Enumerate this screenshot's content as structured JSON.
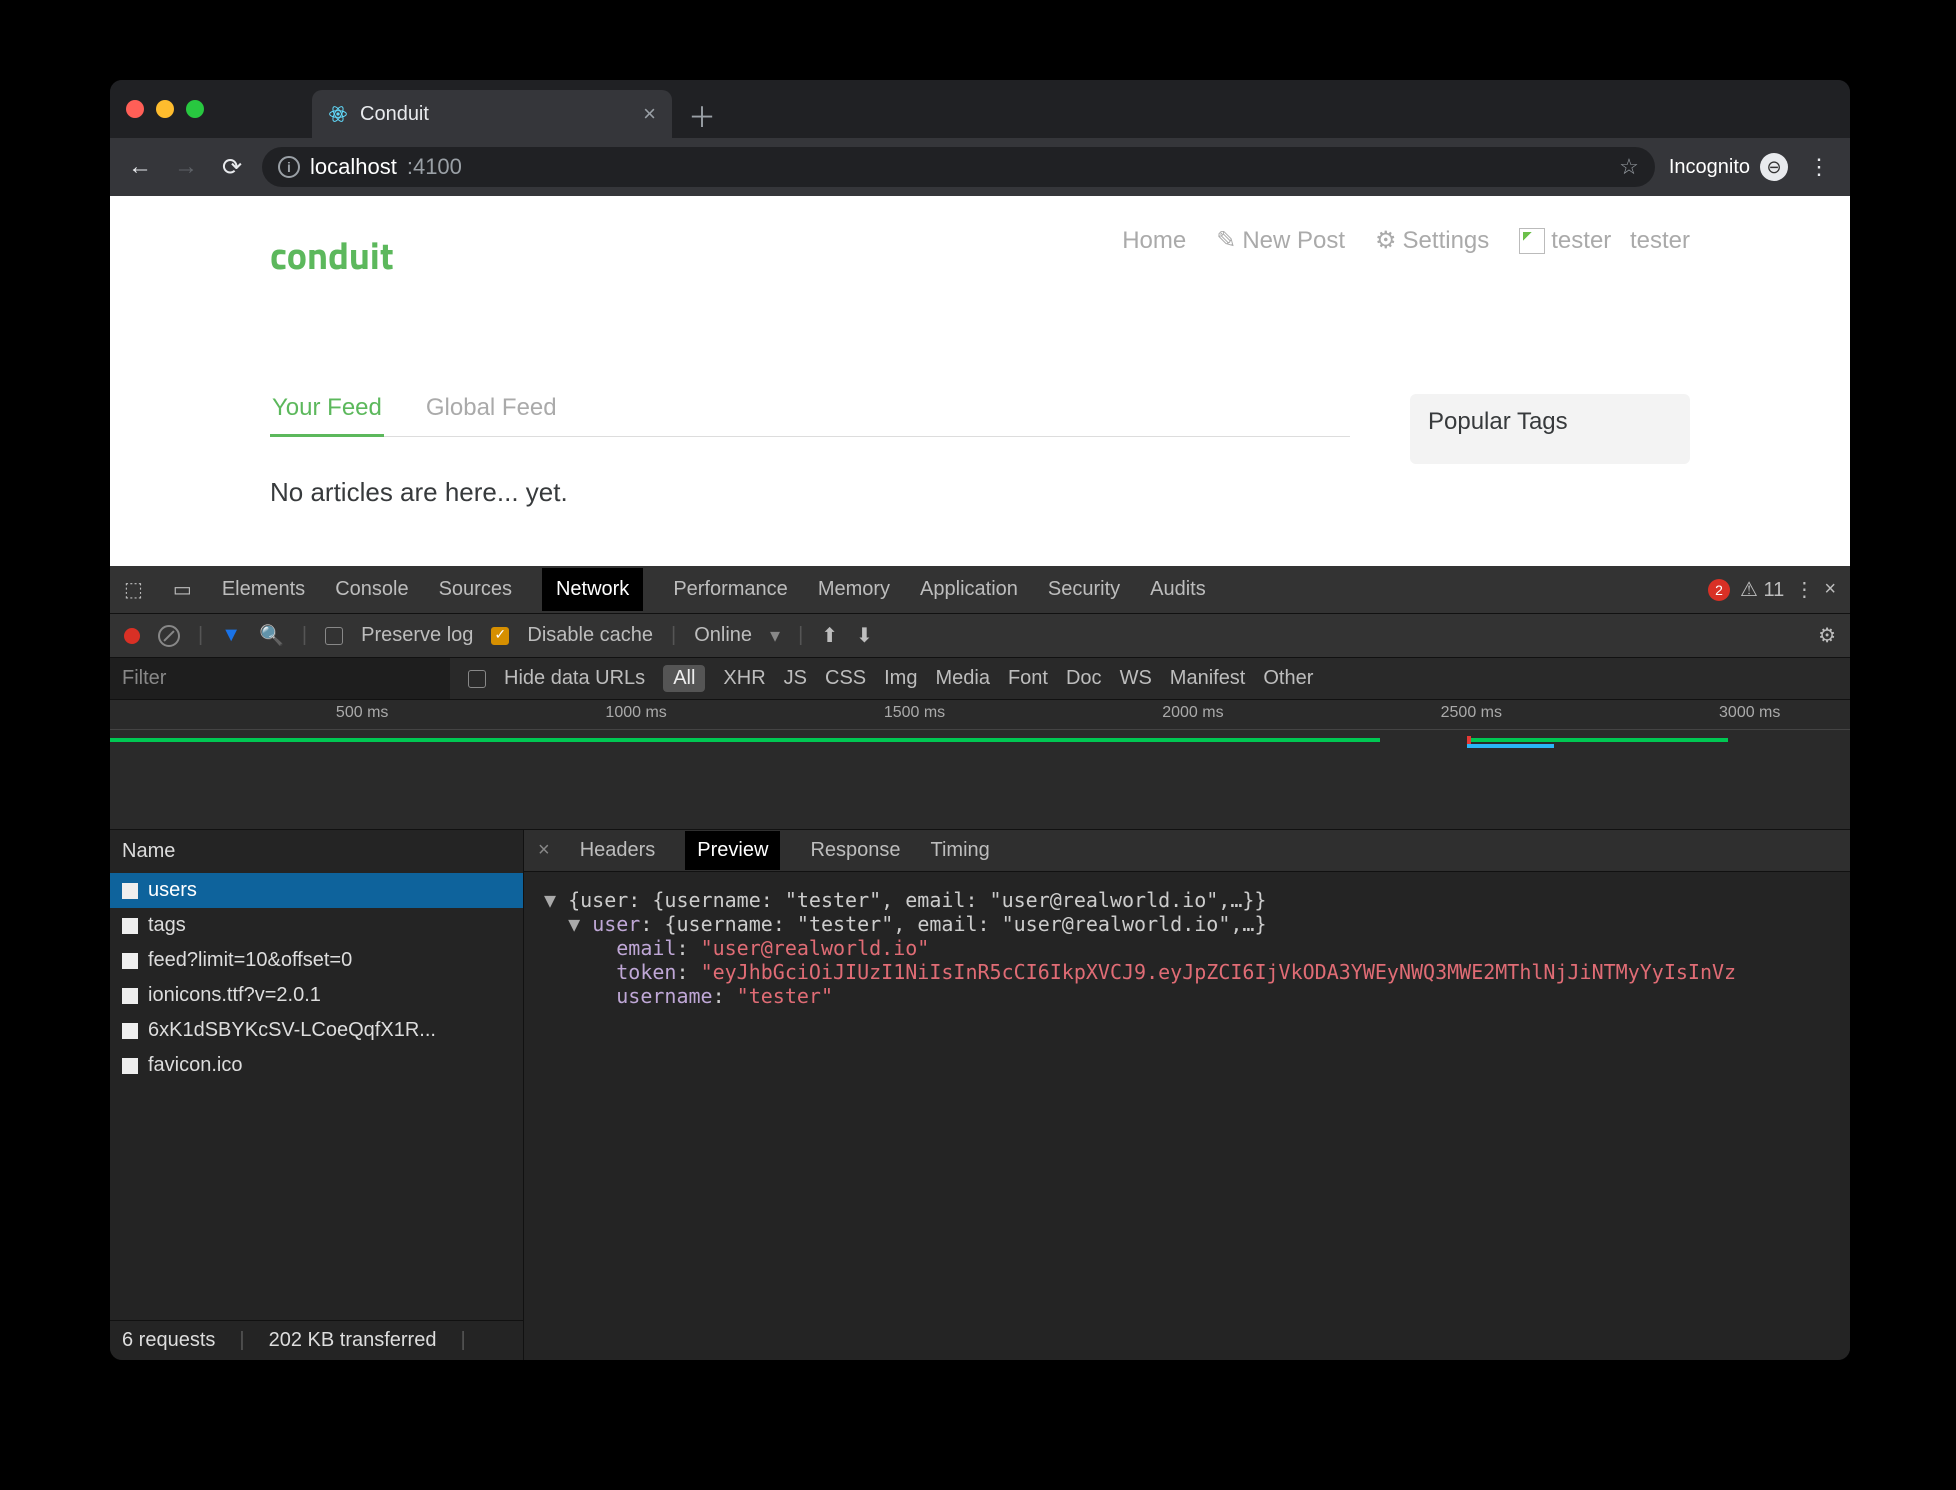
{
  "browser": {
    "tab_title": "Conduit",
    "traffic": [
      "close",
      "min",
      "max"
    ],
    "nav": {
      "back": "←",
      "fwd": "→",
      "reload": "⟳"
    },
    "omnibox": {
      "host": "localhost",
      "rest": ":4100",
      "star": "☆",
      "incognito_label": "Incognito"
    }
  },
  "app": {
    "brand": "conduit",
    "nav": {
      "home": "Home",
      "new_post": "New Post",
      "settings": "Settings",
      "user_alt": "tester",
      "user_label": "tester"
    },
    "tabs": {
      "your_feed": "Your Feed",
      "global_feed": "Global Feed"
    },
    "empty": "No articles are here... yet.",
    "sidebar_title": "Popular Tags"
  },
  "devtools": {
    "panels": [
      "Elements",
      "Console",
      "Sources",
      "Network",
      "Performance",
      "Memory",
      "Application",
      "Security",
      "Audits"
    ],
    "panel_selected": "Network",
    "errors": "2",
    "warnings": "11",
    "subbar": {
      "preserve": "Preserve log",
      "disable": "Disable cache",
      "online": "Online"
    },
    "filter_placeholder": "Filter",
    "hide_label": "Hide data URLs",
    "types": [
      "All",
      "XHR",
      "JS",
      "CSS",
      "Img",
      "Media",
      "Font",
      "Doc",
      "WS",
      "Manifest",
      "Other"
    ],
    "timeline_labels": [
      "500 ms",
      "1000 ms",
      "1500 ms",
      "2000 ms",
      "2500 ms",
      "3000 ms"
    ],
    "name_header": "Name",
    "requests": [
      "users",
      "tags",
      "feed?limit=10&offset=0",
      "ionicons.ttf?v=2.0.1",
      "6xK1dSBYKcSV-LCoeQqfX1R...",
      "favicon.ico"
    ],
    "status": {
      "count": "6 requests",
      "size": "202 KB transferred"
    },
    "detail_tabs": [
      "Headers",
      "Preview",
      "Response",
      "Timing"
    ],
    "detail_selected": "Preview",
    "preview": {
      "root_summary": "{user: {username: \"tester\", email: \"user@realworld.io\",…}}",
      "user_summary": "{username: \"tester\", email: \"user@realworld.io\",…}",
      "email_key": "email",
      "email_val": "\"user@realworld.io\"",
      "token_key": "token",
      "token_val": "\"eyJhbGciOiJIUzI1NiIsInR5cCI6IkpXVCJ9.eyJpZCI6IjVkODA3YWEyNWQ3MWE2MThlNjJiNTMyYyIsInVz",
      "username_key": "username",
      "username_val": "\"tester\""
    }
  }
}
